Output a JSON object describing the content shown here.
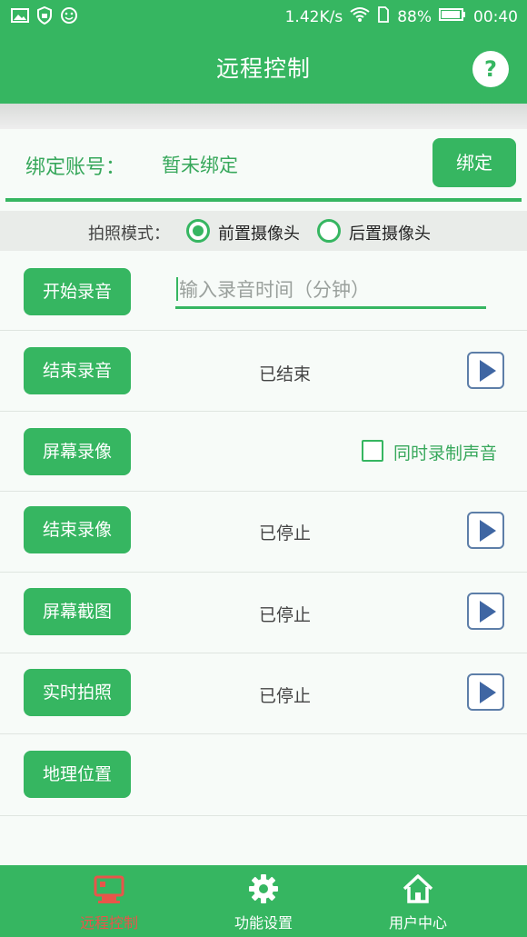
{
  "status_bar": {
    "network_speed": "1.42K/s",
    "battery_percent": "88%",
    "time": "00:40",
    "left_icons": [
      "image-icon",
      "shield-icon",
      "smiley-icon"
    ],
    "right_icons": [
      "wifi-icon",
      "sim-icon",
      "battery-icon"
    ]
  },
  "header": {
    "title": "远程控制",
    "help_label": "?"
  },
  "binding": {
    "label": "绑定账号：",
    "value": "暂未绑定",
    "button_label": "绑定"
  },
  "photo_mode": {
    "label": "拍照模式：",
    "options": [
      {
        "label": "前置摄像头",
        "selected": true
      },
      {
        "label": "后置摄像头",
        "selected": false
      }
    ]
  },
  "actions": {
    "start_recording": {
      "label": "开始录音",
      "input_placeholder": "输入录音时间（分钟）",
      "input_value": ""
    },
    "end_recording": {
      "label": "结束录音",
      "status": "已结束"
    },
    "screen_record": {
      "label": "屏幕录像",
      "checkbox_label": "同时录制声音",
      "checked": false
    },
    "end_screen_record": {
      "label": "结束录像",
      "status": "已停止"
    },
    "screenshot": {
      "label": "屏幕截图",
      "status": "已停止"
    },
    "live_photo": {
      "label": "实时拍照",
      "status": "已停止"
    },
    "location": {
      "label": "地理位置"
    }
  },
  "bottom_nav": {
    "items": [
      {
        "label": "远程控制",
        "icon": "monitor-icon",
        "active": true
      },
      {
        "label": "功能设置",
        "icon": "gear-icon",
        "active": false
      },
      {
        "label": "用户中心",
        "icon": "home-icon",
        "active": false
      }
    ]
  },
  "colors": {
    "primary": "#36b661",
    "active_nav": "#e8554a",
    "play_icon": "#3f66a3"
  }
}
